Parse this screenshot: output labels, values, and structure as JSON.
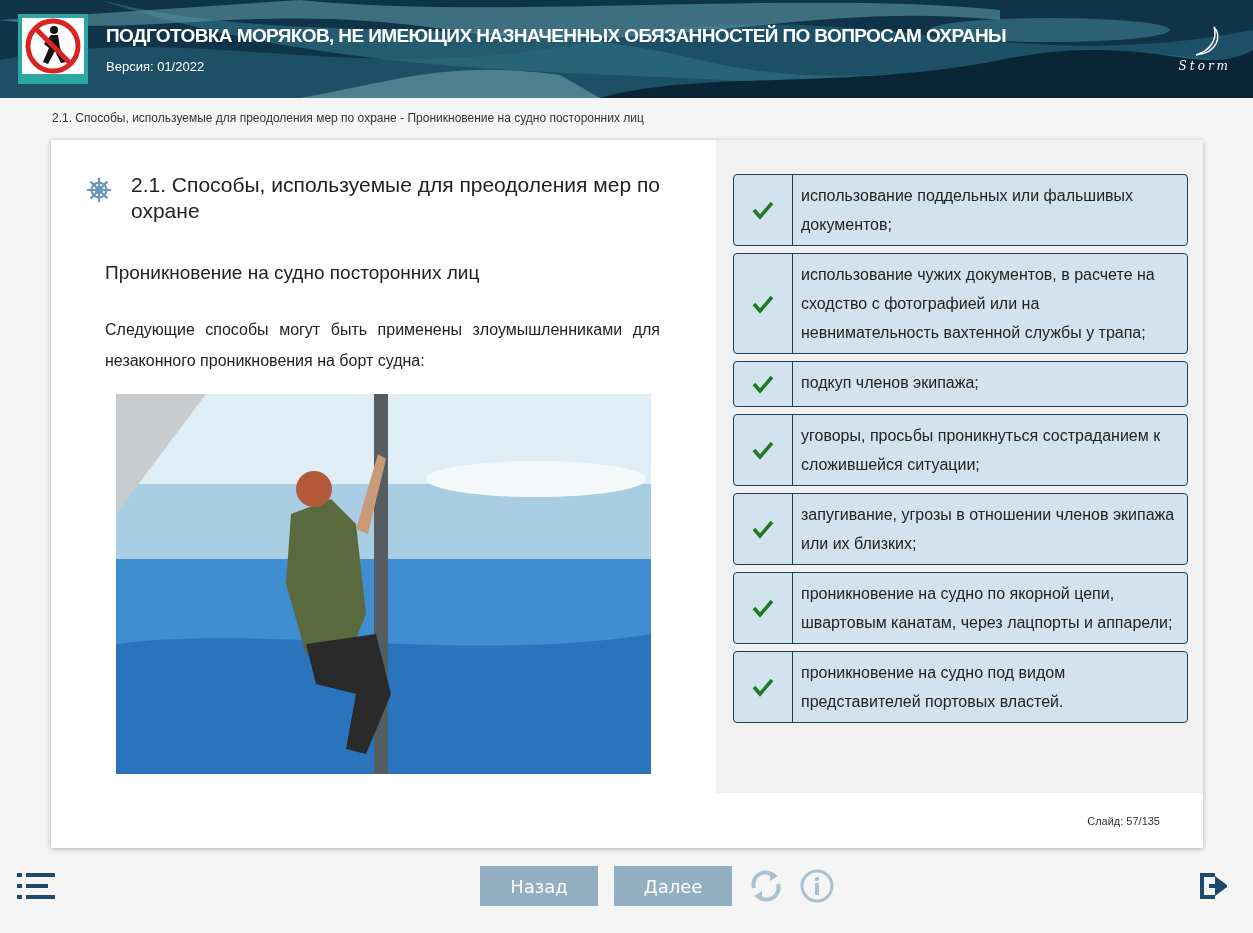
{
  "header": {
    "title": "ПОДГОТОВКА МОРЯКОВ, НЕ ИМЕЮЩИХ НАЗНАЧЕННЫХ ОБЯЗАННОСТЕЙ ПО ВОПРОСАМ ОХРАНЫ",
    "version": "Версия: 01/2022",
    "brand": "Storm"
  },
  "breadcrumb": "2.1. Способы, используемые для преодоления мер по охране - Проникновение на судно посторонних лиц",
  "slide": {
    "heading": "2.1. Способы, используемые для преодоления мер по охране",
    "subheading": "Проникновение на судно посторонних лиц",
    "paragraph": "Следующие способы могут быть применены злоумышленниками для незаконного проникновения на борт судна:",
    "items": [
      {
        "text": "использование поддельных или фальшивых документов;",
        "checked": true
      },
      {
        "text": "использование чужих документов, в расчете на сходство с фотографией или на невнимательность вахтенной службы у трапа;",
        "checked": true
      },
      {
        "text": "подкуп членов экипажа;",
        "checked": true
      },
      {
        "text": "уговоры, просьбы проникнуться состраданием к сложившейся ситуации;",
        "checked": true
      },
      {
        "text": "запугивание, угрозы в отношении членов экипажа или их близких;",
        "checked": true
      },
      {
        "text": "проникновение на судно по якорной цепи, швартовым канатам, через лацпорты и аппарели;",
        "checked": true
      },
      {
        "text": "проникновение на судно под видом представителей портовых властей.",
        "checked": true
      }
    ],
    "counter": "Слайд:  57/135"
  },
  "nav": {
    "buttons": [
      {
        "label": "Назад"
      },
      {
        "label": "Далее"
      }
    ]
  }
}
